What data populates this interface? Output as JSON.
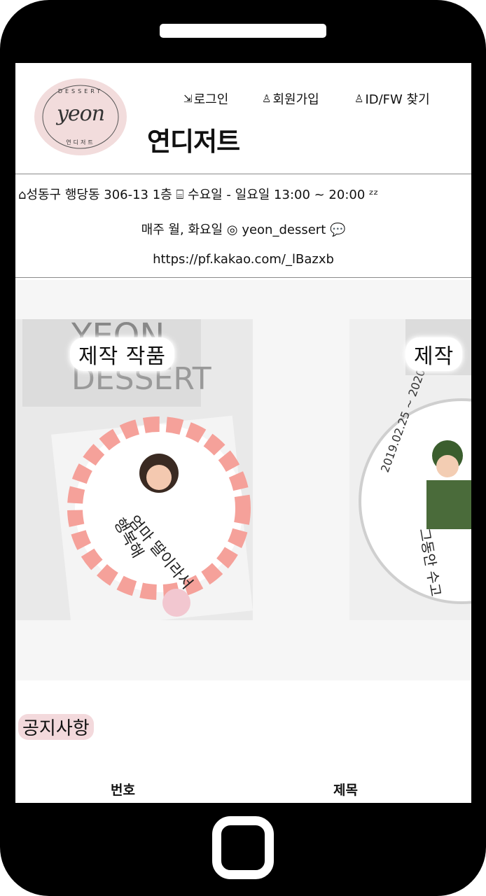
{
  "logo": {
    "script_text": "yeon",
    "top_text": "DESSERT",
    "bottom_text": "연디저트"
  },
  "nav": {
    "login": "로그인",
    "join": "회원가입",
    "find": "ID/FW 찾기"
  },
  "site_title": "연디저트",
  "info": {
    "address": "성동구 행당동 306-13 1층",
    "hours": "수요일 - 일요일 13:00 ~ 20:00",
    "closed": "매주 월, 화요일",
    "instagram": "yeon_dessert",
    "kakao_url": "https://pf.kakao.com/_lBazxb"
  },
  "gallery": {
    "cards": [
      {
        "label": "제작 작품"
      },
      {
        "label": "제작"
      }
    ]
  },
  "notice": {
    "title": "공지사항",
    "columns": [
      "번호",
      "제목"
    ]
  }
}
